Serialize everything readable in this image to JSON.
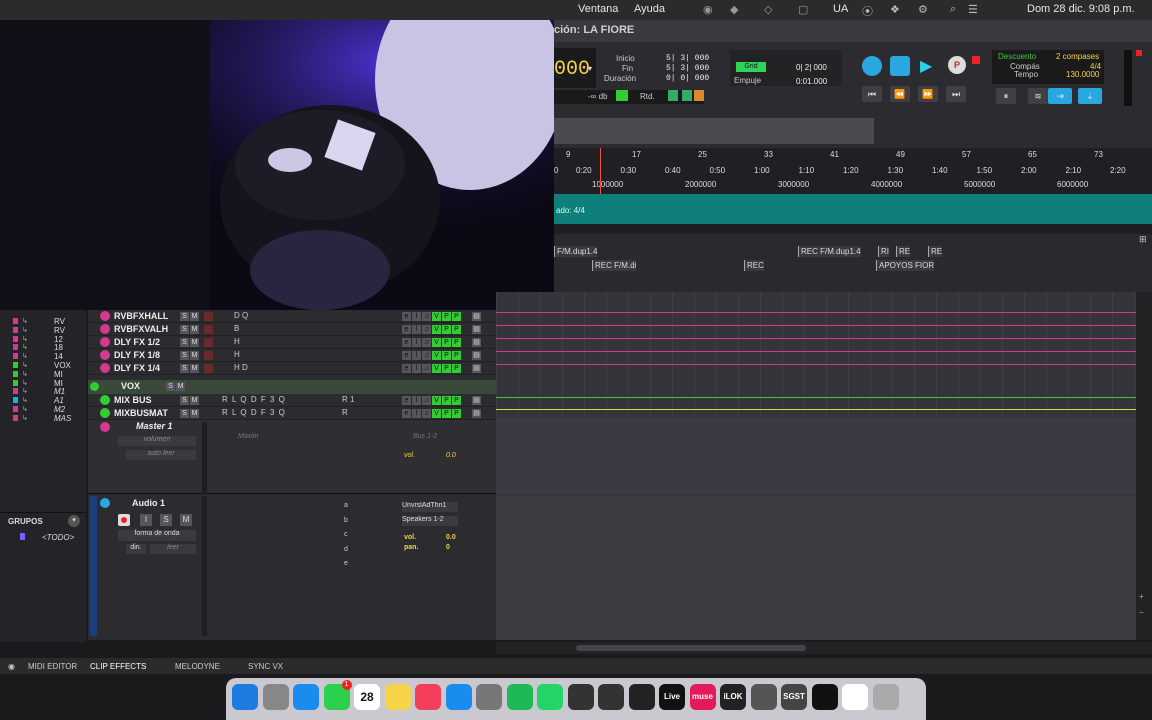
{
  "menubar": {
    "items": [
      "Ventana",
      "Ayuda"
    ],
    "ua": "UA",
    "datetime": "Dom 28 dic.  9:08 p.m."
  },
  "window": {
    "title": "ción: LA FIORE"
  },
  "transport": {
    "main_counter": "000",
    "inicio_label": "Inicio",
    "fin_label": "Fin",
    "duracion_label": "Duración",
    "inicio": "5| 3| 000",
    "fin": "5| 3| 000",
    "duracion": "0| 0| 000",
    "grid_label": "Grid",
    "grid_value": "0| 2| 000",
    "empuje_label": "Empuje",
    "empuje_value": "0:01.000",
    "db": "-∞ db",
    "rtd": "Rtd.",
    "descuento_label": "Descuento",
    "compas_label": "Compás",
    "tempo_label": "Tempo",
    "descuento_value": "2 compases",
    "compas_value": "4/4",
    "tempo_value": "130.0000"
  },
  "ruler": {
    "bars": [
      "9",
      "17",
      "25",
      "33",
      "41",
      "49",
      "57",
      "65",
      "73"
    ],
    "times": [
      "0",
      "0:20",
      "0:30",
      "0:40",
      "0:50",
      "1:00",
      "1:10",
      "1:20",
      "1:30",
      "1:40",
      "1:50",
      "2:00",
      "2:10",
      "2:20"
    ],
    "samples": [
      "1000000",
      "2000000",
      "3000000",
      "4000000",
      "5000000",
      "6000000"
    ]
  },
  "metre": "ado: 4/4",
  "markers": {
    "row1": [
      "F/M.dup1.4",
      "REC F/M.dup1.4",
      "RI",
      "RE",
      "RE"
    ],
    "row2": [
      "REC F/M.di",
      "REC",
      "APOYOS FIOR"
    ]
  },
  "tracks": {
    "aux": [
      {
        "name": "RVBFXHALL",
        "io": "D Q"
      },
      {
        "name": "RVBFXVALH",
        "io": "B"
      },
      {
        "name": "DLY FX 1/2",
        "io": "H"
      },
      {
        "name": "DLY FX 1/8",
        "io": "H"
      },
      {
        "name": "DLY FX 1/4",
        "io": "H D"
      }
    ],
    "vox_folder": "VOX",
    "buses": [
      {
        "name": "MIX BUS",
        "inserts": "R L Q D F 3 Q",
        "send": "R 1"
      },
      {
        "name": "MIXBUSMAT",
        "inserts": "R L Q D F 3 Q",
        "send": "R"
      }
    ],
    "master": {
      "name": "Master 1",
      "view": "volumen",
      "auto": "auto leer",
      "plugin": "Maxim",
      "out": "Bus 1-2",
      "vol_label": "vol.",
      "vol": "0.0"
    },
    "audio": {
      "name": "Audio 1",
      "view": "forma de onda",
      "din": "din.",
      "leer": "leer",
      "io_in": "UnvrslAdThn1",
      "io_out": "Speakers 1-2",
      "vol_label": "vol.",
      "vol": "0.0",
      "pan_label": "pan.",
      "pan": "0",
      "sends": [
        "a",
        "b",
        "c",
        "d",
        "e"
      ]
    }
  },
  "leftpanel": {
    "items": [
      "RV",
      "RV",
      "12",
      "18",
      "14",
      "VOX",
      "MI",
      "MI",
      "M1",
      "A1",
      "M2",
      "MAS"
    ]
  },
  "groups": {
    "header": "GRUPOS",
    "item": "<TODO>"
  },
  "bottombar": {
    "tabs": [
      "MIDI EDITOR",
      "CLIP EFFECTS",
      "MELODYNE",
      "SYNC VX"
    ]
  },
  "dock": {
    "apps": [
      "Finder",
      "Launchpad",
      "Safari",
      "Messages",
      "Calendar",
      "Notes",
      "Music",
      "App Store",
      "System Settings",
      "Spotify",
      "WhatsApp",
      "Pro Tools",
      "Audio MIDI",
      "Avid",
      "Live",
      "muse",
      "iLok",
      "Time Machine",
      "SGST",
      "Piano",
      "Preview",
      "Trash"
    ],
    "calendar_day": "28",
    "calendar_month": "DIC",
    "live_label": "Live",
    "muse_label": "muse",
    "ilok_label": "iLOK",
    "sgst_label": "SGST",
    "badge": "1"
  },
  "colors": {
    "accent": "#d4398f",
    "teal": "#0e7f7b",
    "green": "#33cc33",
    "transport_play": "#2aa7e0"
  }
}
